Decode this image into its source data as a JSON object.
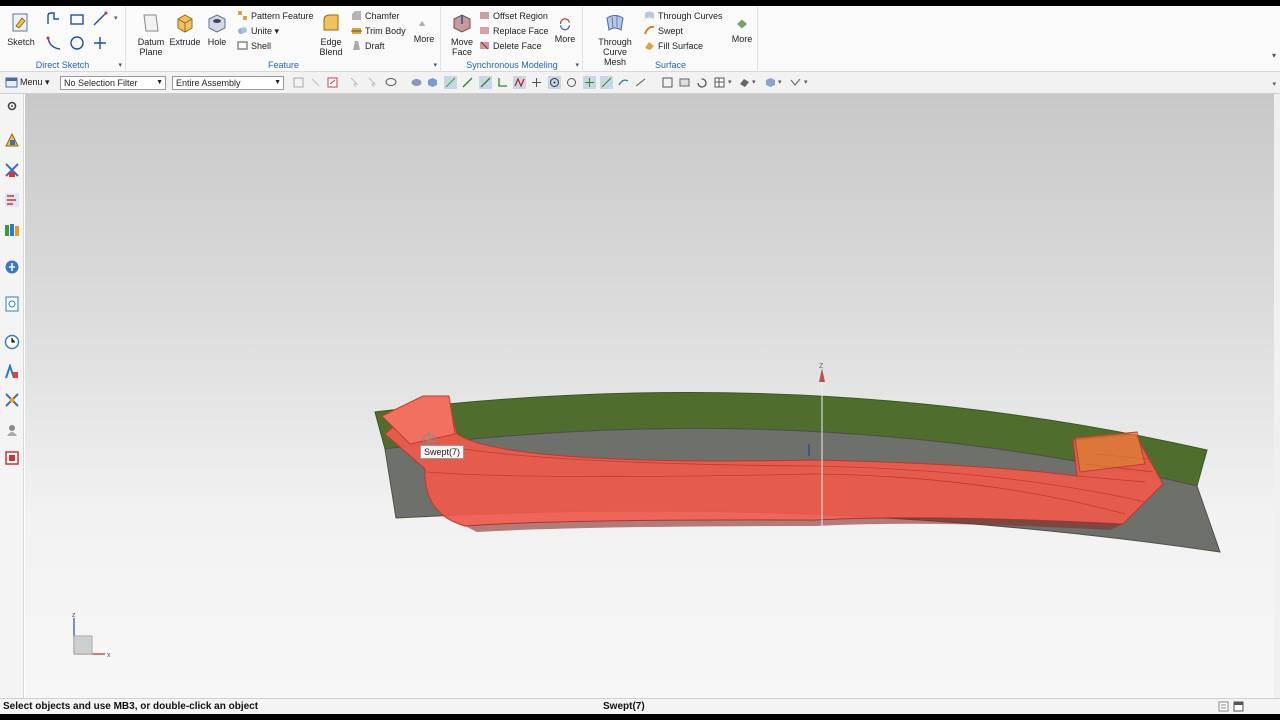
{
  "ribbon": {
    "direct_sketch": {
      "label": "Direct Sketch",
      "sketch": "Sketch"
    },
    "feature": {
      "label": "Feature",
      "datum_plane": "Datum Plane",
      "extrude": "Extrude",
      "hole": "Hole",
      "pattern_feature": "Pattern Feature",
      "unite": "Unite",
      "shell": "Shell",
      "edge_blend": "Edge Blend",
      "chamfer": "Chamfer",
      "trim_body": "Trim Body",
      "draft": "Draft",
      "more": "More"
    },
    "synchronous": {
      "label": "Synchronous Modeling",
      "move_face": "Move Face",
      "offset_region": "Offset Region",
      "replace_face": "Replace Face",
      "delete_face": "Delete Face",
      "more": "More"
    },
    "surface": {
      "label": "Surface",
      "through_curve_mesh": "Through Curve Mesh",
      "through_curves": "Through Curves",
      "swept": "Swept",
      "fill_surface": "Fill Surface",
      "more": "More"
    }
  },
  "cmdbar": {
    "menu": "Menu",
    "selection_filter": "No Selection Filter",
    "scope": "Entire Assembly"
  },
  "viewport": {
    "tooltip": "Swept(7)",
    "axis_z": "Z",
    "axis_x": "X",
    "triad_z": "z",
    "triad_x": "x"
  },
  "status": {
    "prompt": "Select objects and use MB3, or double-click an object",
    "selection": "Swept(7)"
  },
  "colors": {
    "accent": "#2a64b8",
    "swept_body": "#f0594c",
    "surface_green": "#4f6e2e",
    "surface_gray": "#6d706b"
  }
}
